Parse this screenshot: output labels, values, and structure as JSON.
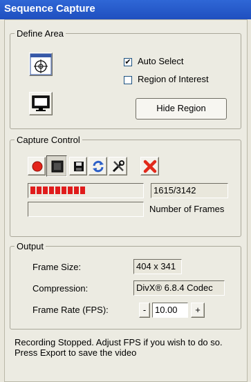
{
  "window": {
    "title": "Sequence Capture"
  },
  "define_area": {
    "legend": "Define Area",
    "auto_select": {
      "label": "Auto Select",
      "checked": true
    },
    "region_of_interest": {
      "label": "Region of Interest",
      "checked": false
    },
    "hide_region_label": "Hide Region"
  },
  "capture_control": {
    "legend": "Capture Control",
    "frame_counter": "1615/3142",
    "progress_fraction": 0.51,
    "number_of_frames_label": "Number of Frames",
    "icons": [
      "record-icon",
      "stop-icon",
      "save-icon",
      "refresh-icon",
      "settings-icon",
      "close-icon"
    ]
  },
  "output": {
    "legend": "Output",
    "frame_size_label": "Frame Size:",
    "frame_size_value": "404 x 341",
    "compression_label": "Compression:",
    "compression_value": "DivX® 6.8.4 Codec",
    "frame_rate_label": "Frame Rate (FPS):",
    "frame_rate_value": "10.00",
    "decrement_label": "-",
    "increment_label": "+"
  },
  "status_text": "Recording Stopped. Adjust FPS if you wish to do so. Press Export to save the video"
}
